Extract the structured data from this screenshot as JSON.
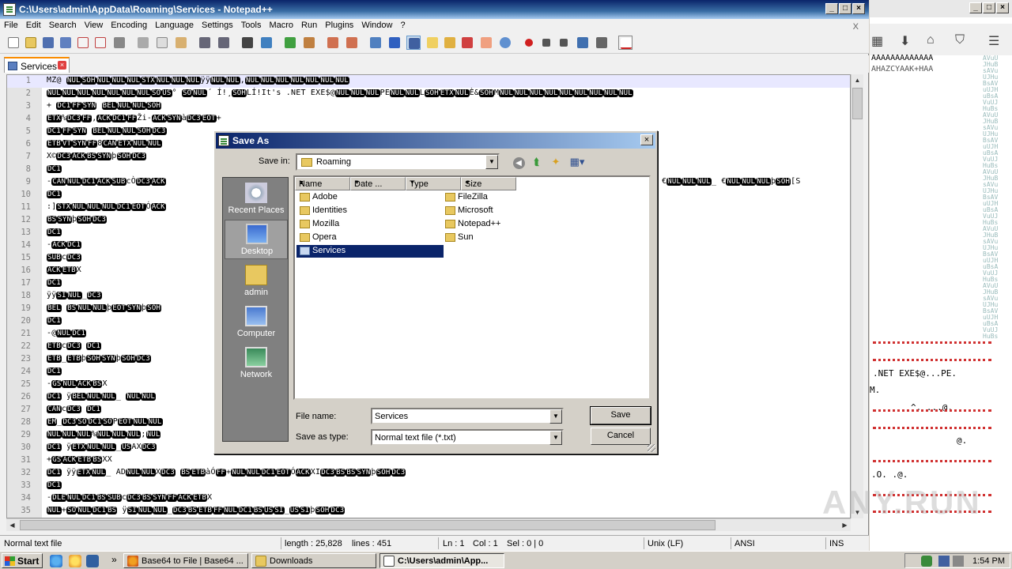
{
  "window": {
    "title": "C:\\Users\\admin\\AppData\\Roaming\\Services - Notepad++",
    "menu_close": "X",
    "minimize": "_",
    "maximize": "□",
    "close": "×"
  },
  "menu": [
    "File",
    "Edit",
    "Search",
    "View",
    "Encoding",
    "Language",
    "Settings",
    "Tools",
    "Macro",
    "Run",
    "Plugins",
    "Window",
    "?"
  ],
  "tab": {
    "label": "Services"
  },
  "editor": {
    "lines": [
      "MZ@ [NUL][SOH][NUL][NUL][NUL][STX][NUL][NUL][NUL]ÿÿ[NUL][NUL],[NUL][NUL][NUL][NUL][NUL][NUL][NUL]",
      "[NUL][NUL][NUL][NUL][NUL][NUL][NUL][SO][US]° [SO][NUL]´    Í!¸[SOH]LÍ!It's .NET EXE$@[NUL][NUL][NUL]PE[NUL][NUL]L[SOH][ETX][NUL]È&[SOH]M[NUL][NUL][NUL][NUL][NUL][NUL][NUL][NUL][NUL]",
      "+   [DC1][FF][SYN] [BEL][NUL][NUL][SOH]",
      "[ETX]%[DC3][FF],[ACK][DC1][FF]Ži-[ACK][SYN]à[DC3][EOT]+",
      "[DC1][FF][SYN] [BEL][NUL][NUL][SOH][DC3]",
      "[ETB][VT][SYN][FF]8[CAN][ETX][NUL][NUL]",
      "X©[DC3][ACK][BS][SYN]þ[SOH][DC3]",
      "[DC1]",
      "-[CAN][NUL][DC1][ACK][SUB]cÒ[DC3][ACK]",
      "[DC1]",
      ":][STX][NUL][NUL][NUL][DC1][EOT]Ó[ACK]",
      "[BS][SYN]þ[SOH][DC3]",
      "[DC1]",
      "-[ACK][DC1]",
      "[SUB]c[DC3]",
      "[ACK][ETB]X",
      "[DC1]",
      " ÿÿ[SI][NUL]_[DC3]",
      "[BEL]  [BS][NUL][NUL]þ[EOT][SYN]þ[SOH]",
      "[DC1]",
      "-@[NUL][DC1]",
      "[ETB]c[DC3]     [DC1]",
      "[ETB]_[ETB]þ[SOH][SYN]þ[SOH][DC3]",
      "[DC1]",
      "-[GS][NUL][ACK][BS]X",
      "[DC1] ÿ[BEL][NUL][NUL]_  [NUL][NUL]",
      "[CAN]c[DC3]     [DC1]",
      "[EM]_[DC3][SO][DC1][SO]P[EOT][NUL][NUL]",
      "[NUL][NUL][NUL]%[NUL][NUL][NUL];[NUL]",
      "[DC1] ÿ[ETX][NUL][NUL]_[US]AX[DC3]",
      "+[GS][ACK][ETB][BS]XX",
      "[DC1] ÿÿ[ETX][NUL]_ AD[NUL][NUL]X[DC3]   [BS][ETB]àÓ[FF]+[NUL][NUL][DC1][EOT]Ó[ACK]XI[DC3][BS][BS][SYN]þ[SOH][DC3]",
      "[DC1]",
      "-[DLE][NUL][DC1][BS][SUB]c[DC3][BS][SYN][FF][ACK][ETB]X",
      "[NUL]+[SO][NUL][DC1][BS] ÿ[SI][NUL][NUL]_[DC3][BS][ETB][FF][NUL][DC1][BS][US][SI]_[US][SI]þ[SOH][DC3]"
    ],
    "line9_tail": "€[NUL][NUL][NUL]_ €[NUL][NUL][NUL]þ[SOH][S"
  },
  "status": {
    "type": "Normal text file",
    "length": "length : 25,828",
    "lines": "lines : 451",
    "ln": "Ln : 1",
    "col": "Col : 1",
    "sel": "Sel : 0 | 0",
    "eol": "Unix (LF)",
    "encoding": "ANSI",
    "mode": "INS"
  },
  "dialog": {
    "title": "Save As",
    "save_in_label": "Save in:",
    "save_in_value": "Roaming",
    "columns": [
      "Name",
      "Date ...",
      "Type",
      "Size"
    ],
    "places": [
      "Recent Places",
      "Desktop",
      "admin",
      "Computer",
      "Network"
    ],
    "items_col1": [
      "Adobe",
      "Identities",
      "Mozilla",
      "Opera",
      "Services"
    ],
    "items_col2": [
      "FileZilla",
      "Microsoft",
      "Notepad++",
      "Sun"
    ],
    "file_name_label": "File name:",
    "file_name_value": "Services",
    "save_as_type_label": "Save as type:",
    "save_as_type_value": "Normal text file (*.txt)",
    "save_button": "Save",
    "cancel_button": "Cancel",
    "close": "×"
  },
  "right_window": {
    "text1": "AAAAAAAAAAAAA",
    "text2": "AHAZCYAAK+HAA",
    "text3": ".NET EXE$@...PE.",
    "text4": "M.",
    "text5": "^.     ...@.",
    "text6": "@.",
    "text7": ".O.    .@.",
    "hex_col": "AVuUJHuBsAVuUJHuBsAVuUJHuBsAVuUJHuBsAVuUJHuBsAVuUJHuBsAVuUJHuBsAVuUJHuBsAVuUJHuBsAVuUJHuBsAVuUJHuBsAVuUJHuBsAVuUJHuBsAVuUJHuBsAVuUJHuBsAVuUJHuBsAVuUJHuBsAVuUJHuBsAVuUJHuBsAVuUJHuBs"
  },
  "taskbar": {
    "start": "Start",
    "more": "»",
    "tasks": [
      "Base64 to File | Base64 ...",
      "Downloads",
      "C:\\Users\\admin\\App..."
    ],
    "clock": "1:54 PM"
  },
  "watermark": "ANY.RUN"
}
